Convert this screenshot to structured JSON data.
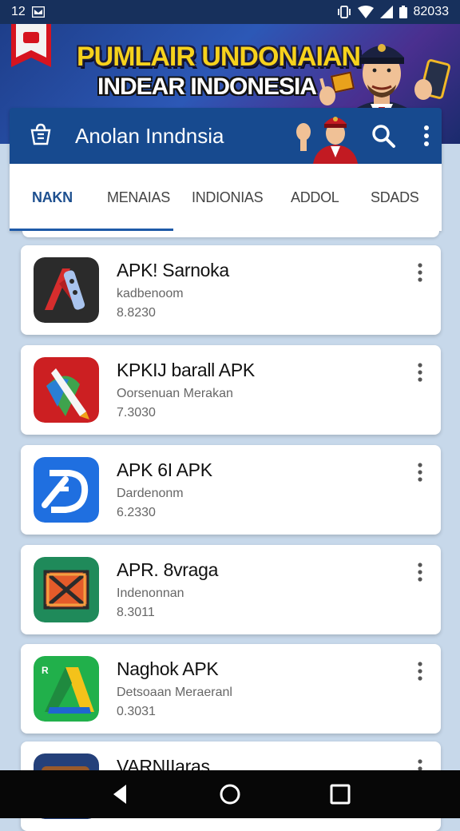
{
  "status_bar": {
    "time": "12",
    "right_text": "82033",
    "icons": [
      "notification-icon",
      "vibrate-icon",
      "wifi-icon",
      "signal-icon",
      "battery-icon"
    ]
  },
  "banner": {
    "title_line1": "PUMLAIR UNDONAIAN",
    "title_line2": "INDEAR INDONESIA",
    "flag_colors": [
      "#d6141f",
      "#ffffff"
    ]
  },
  "toolbar": {
    "title": "Anolan Inndnsia",
    "background_color": "#174a8f",
    "icons": [
      "store-icon",
      "officer-avatar",
      "search-icon",
      "more-vert-icon"
    ]
  },
  "tabs": [
    {
      "label": "NAKN",
      "active": true
    },
    {
      "label": "MENAIAS",
      "active": false
    },
    {
      "label": "INDIONIAS",
      "active": false
    },
    {
      "label": "ADDOL",
      "active": false
    },
    {
      "label": "SDADS",
      "active": false
    }
  ],
  "apps": [
    {
      "name": "APK! Sarnoka",
      "subtitle": "kadbenoom",
      "version": "8.8230",
      "icon": "dark-wrench-icon"
    },
    {
      "name": "KPKIJ barall APK",
      "subtitle": "Oorsenuan Merakan",
      "version": "7.3030",
      "icon": "red-pencil-icon"
    },
    {
      "name": "APK 6I APK",
      "subtitle": "Dardenonm",
      "version": "6.2330",
      "icon": "blue-d-icon"
    },
    {
      "name": "APR. 8vraga",
      "subtitle": "Indenonnan",
      "version": "8.3011",
      "icon": "green-envelope-icon"
    },
    {
      "name": "Naghok APK",
      "subtitle": "Detsoaan Meraeranl",
      "version": "0.3031",
      "icon": "green-drive-icon"
    },
    {
      "name": "VARNIIaras",
      "subtitle": "",
      "version": "",
      "icon": "brown-bag-icon"
    }
  ],
  "navbar": {
    "icons": [
      "back-icon",
      "home-icon",
      "recents-icon"
    ]
  }
}
